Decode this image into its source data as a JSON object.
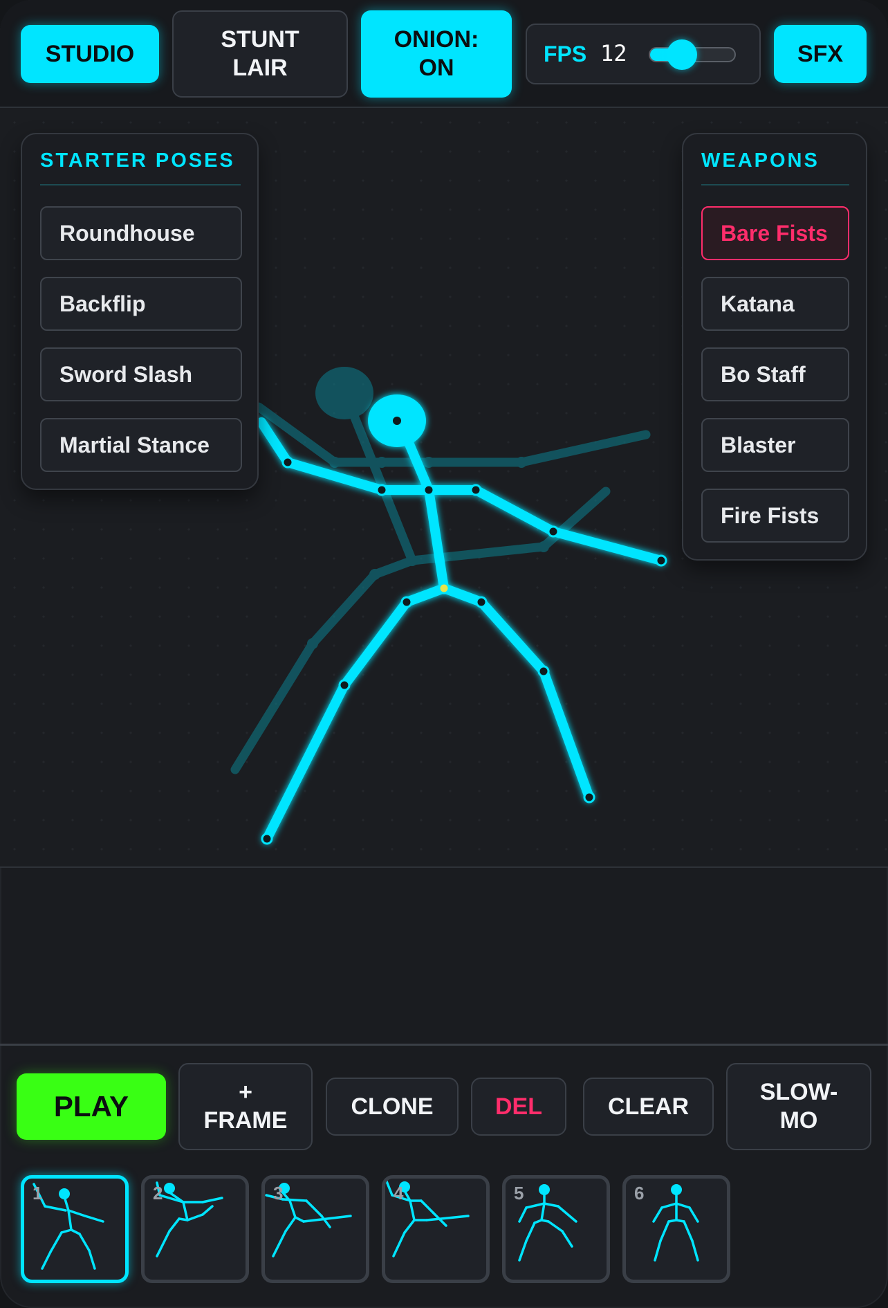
{
  "topbar": {
    "studio": "STUDIO",
    "stunt_lair": "STUNT LAIR",
    "onion": "ONION: ON",
    "fps_label": "FPS",
    "fps_value": "12",
    "fps_slider_level": 0.38,
    "sfx": "SFX"
  },
  "starter_poses": {
    "title": "STARTER POSES",
    "items": [
      "Roundhouse",
      "Backflip",
      "Sword Slash",
      "Martial Stance"
    ]
  },
  "weapons": {
    "title": "WEAPONS",
    "items": [
      "Bare Fists",
      "Katana",
      "Bo Staff",
      "Blaster",
      "Fire Fists"
    ],
    "selected": "Bare Fists"
  },
  "controls": {
    "play": "PLAY",
    "add_frame": "+ FRAME",
    "clone": "CLONE",
    "del": "DEL",
    "clear": "CLEAR",
    "slow_mo": "SLOW- MO"
  },
  "timeline": {
    "frames": [
      "1",
      "2",
      "3",
      "4",
      "5",
      "6"
    ],
    "selected_frame": "1"
  },
  "colors": {
    "accent": "#00e5ff",
    "play": "#39ff14",
    "danger": "#ff2d6b",
    "background": "#1a1c20"
  }
}
